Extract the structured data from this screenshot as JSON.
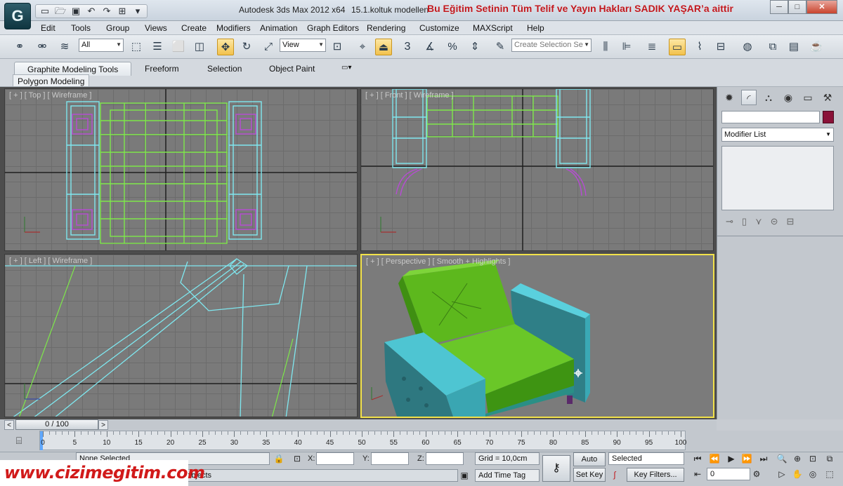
{
  "titlebar": {
    "app_title": "Autodesk 3ds Max  2012 x64",
    "file_name": "15.1.koltuk modellen",
    "copyright": "Bu Eğitim Setinin Tüm Telif ve Yayın Hakları SADIK YAŞAR’a aittir",
    "minimize": "─",
    "restore": "□",
    "close": "✕"
  },
  "menu": [
    "Edit",
    "Tools",
    "Group",
    "Views",
    "Create",
    "Modifiers",
    "Animation",
    "Graph Editors",
    "Rendering",
    "Customize",
    "MAXScript",
    "Help"
  ],
  "toolbar": {
    "filter_value": "All",
    "refcoord_value": "View",
    "named_selection_placeholder": "Create Selection Se",
    "snap_label": "3"
  },
  "ribbon": {
    "tabs": [
      "Graphite Modeling Tools",
      "Freeform",
      "Selection",
      "Object Paint"
    ],
    "subtab": "Polygon Modeling"
  },
  "viewports": {
    "top": "[ + ] [ Top ] [ Wireframe ]",
    "front": "[ + ] [ Front ] [ Wireframe ]",
    "left": "[ + ] [ Left ] [ Wireframe ]",
    "perspective": "[ + ] [ Perspective ] [ Smooth + Highlights ]"
  },
  "command_panel": {
    "modifier_list": "Modifier List",
    "object_color": "#8a1238"
  },
  "timeslider": {
    "frame_display": "0 / 100",
    "prev": "<",
    "next": ">"
  },
  "trackbar": {
    "ticks": [
      "0",
      "5",
      "10",
      "15",
      "20",
      "25",
      "30",
      "35",
      "40",
      "45",
      "50",
      "55",
      "60",
      "65",
      "70",
      "75",
      "80",
      "85",
      "90",
      "95",
      "100"
    ]
  },
  "status": {
    "selection_info": "None Selected",
    "prompt": "e objects",
    "x_label": "X:",
    "y_label": "Y:",
    "z_label": "Z:",
    "grid": "Grid = 10,0cm",
    "add_time_tag": "Add Time Tag",
    "auto_key": "Auto Key",
    "set_key": "Set Key",
    "key_mode_value": "Selected",
    "key_filters": "Key Filters...",
    "current_frame": "0"
  },
  "watermark": "www.cizimegitim.com",
  "colors": {
    "active_viewport_border": "#f2e24a",
    "wire_cyan": "#7fe8f0",
    "wire_green": "#7ee84a",
    "wire_magenta": "#b84bd6"
  }
}
